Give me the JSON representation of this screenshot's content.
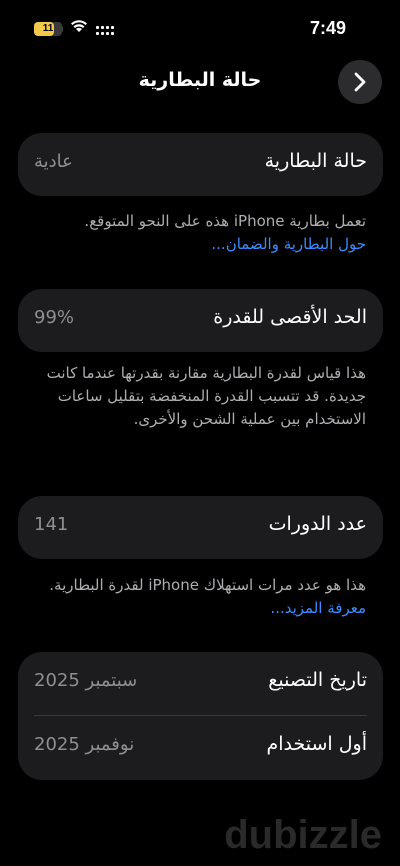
{
  "status_bar": {
    "time": "7:49",
    "battery_level": "11"
  },
  "nav": {
    "title": "حالة البطارية"
  },
  "battery_health": {
    "label": "حالة البطارية",
    "value": "عادية",
    "footer_text": "تعمل بطارية iPhone هذه على النحو المتوقع.",
    "footer_link": "حول البطارية والضمان..."
  },
  "max_capacity": {
    "label": "الحد الأقصى للقدرة",
    "value": "99%",
    "footer_text": "هذا قياس لقدرة البطارية مقارنة بقدرتها عندما كانت جديدة. قد تتسبب القدرة المنخفضة بتقليل ساعات الاستخدام بين عملية الشحن والأخرى."
  },
  "cycle_count": {
    "label": "عدد الدورات",
    "value": "141",
    "footer_text": "هذا هو عدد مرات استهلاك iPhone لقدرة البطارية.",
    "footer_link": "معرفة المزيد..."
  },
  "dates": {
    "manufacture_label": "تاريخ التصنيع",
    "manufacture_value": "سبتمبر 2025",
    "first_use_label": "أول استخدام",
    "first_use_value": "نوفمبر 2025"
  },
  "watermark": "dubizzle",
  "colors": {
    "background": "#000000",
    "card": "#1c1c1e",
    "link": "#3a8cff",
    "battery": "#f2c94c"
  },
  "icons": [
    "wifi-icon",
    "signal-icon",
    "battery-icon",
    "chevron-right-icon"
  ]
}
